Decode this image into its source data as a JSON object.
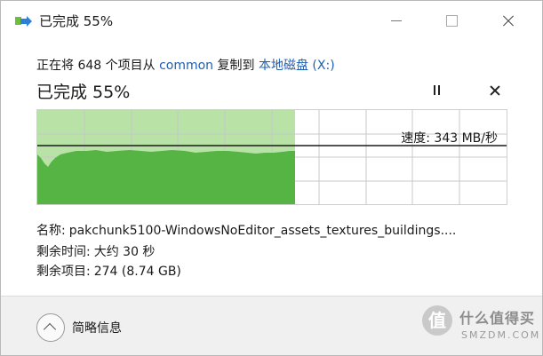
{
  "window": {
    "title": "已完成 55%",
    "buttons": {
      "minimize": "minimize",
      "maximize": "maximize",
      "close": "close"
    }
  },
  "copy": {
    "prefix": "正在将 648 个项目从 ",
    "source": "common",
    "middle": " 复制到 ",
    "destination": "本地磁盘 (X:)",
    "status": "已完成 55%",
    "progress_fraction": 0.55,
    "speed_label": "速度: 343 MB/秒",
    "colors": {
      "progress_bg": "#b8e2a6",
      "graph_fill": "#56b444",
      "grid": "#c8c8c8",
      "link": "#1e5fb3"
    }
  },
  "details": {
    "name_key": "名称:",
    "name_value": "pakchunk5100-WindowsNoEditor_assets_textures_buildings....",
    "time_key": "剩余时间:",
    "time_value": "大约 30 秒",
    "items_key": "剩余项目:",
    "items_value": "274 (8.74 GB)"
  },
  "footer": {
    "toggle_label": "简略信息",
    "toggle_icon": "chevron-up-icon"
  },
  "watermark": {
    "badge": "值",
    "text": "什么值得买",
    "sub": "SMZDM.COM"
  }
}
